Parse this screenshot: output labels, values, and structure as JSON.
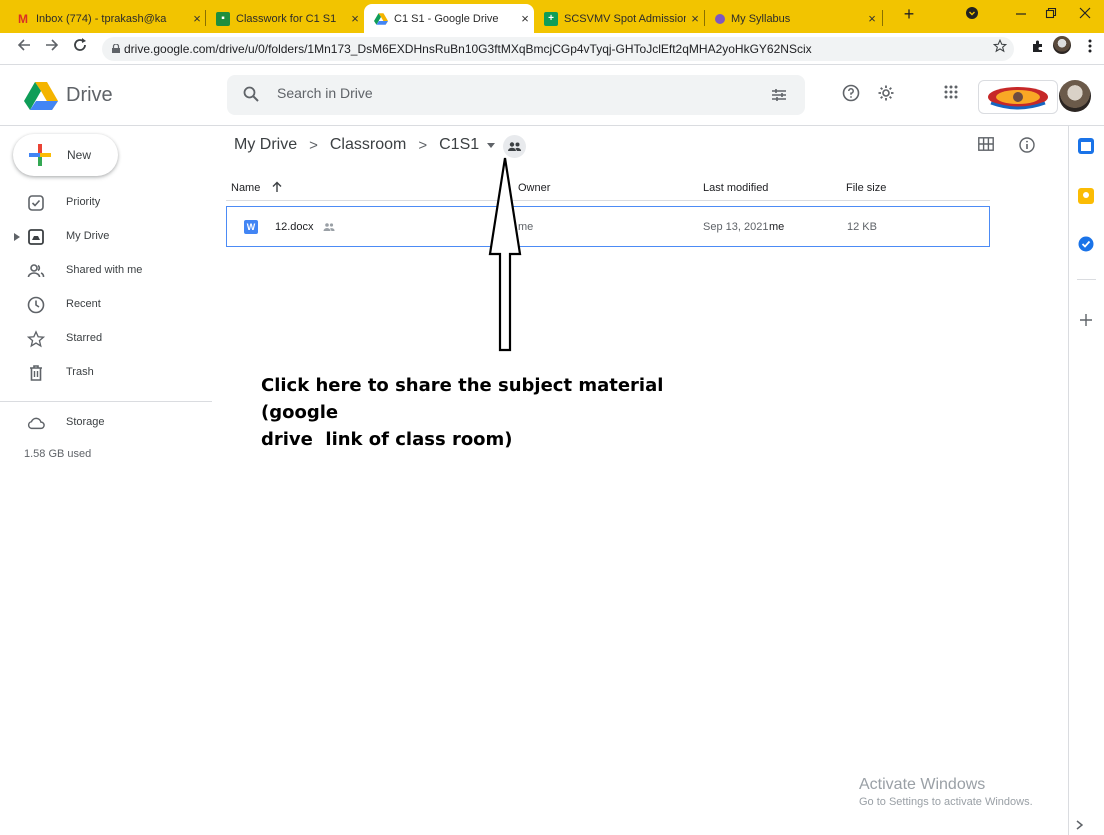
{
  "browser": {
    "tabs": [
      {
        "title": "Inbox (774) - tprakash@ka",
        "favicon": "gmail-icon",
        "active": false
      },
      {
        "title": "Classwork for C1 S1",
        "favicon": "classroom-icon",
        "active": false
      },
      {
        "title": "C1 S1 - Google Drive",
        "favicon": "drive-icon",
        "active": true
      },
      {
        "title": "SCSVMV Spot Admission",
        "favicon": "sheets-icon",
        "active": false
      },
      {
        "title": "My Syllabus",
        "favicon": "site-icon",
        "active": false
      }
    ],
    "close_glyph": "×",
    "new_tab_glyph": "+",
    "url": "drive.google.com/drive/u/0/folders/1Mn173_DsM6EXDHnsRuBn10G3ftMXqBmcjCGp4vTyqj-GHToJclEft2qMHA2yoHkGY62NScix"
  },
  "header": {
    "app_title": "Drive",
    "search_placeholder": "Search in Drive"
  },
  "sidebar": {
    "new_label": "New",
    "items": [
      {
        "label": "Priority",
        "icon": "priority-icon"
      },
      {
        "label": "My Drive",
        "icon": "my-drive-icon"
      },
      {
        "label": "Shared with me",
        "icon": "shared-icon"
      },
      {
        "label": "Recent",
        "icon": "clock-icon"
      },
      {
        "label": "Starred",
        "icon": "star-icon"
      },
      {
        "label": "Trash",
        "icon": "trash-icon"
      }
    ],
    "storage_label": "Storage",
    "storage_used": "1.58 GB used"
  },
  "main": {
    "breadcrumb": [
      "My Drive",
      "Classroom",
      "C1S1"
    ],
    "breadcrumb_sep": ">",
    "columns": {
      "name": "Name",
      "owner": "Owner",
      "last_modified": "Last modified",
      "file_size": "File size"
    },
    "files": [
      {
        "name": "12.docx",
        "owner": "me",
        "modified_date": "Sep 13, 2021",
        "modified_by": "me",
        "size": "12 KB"
      }
    ]
  },
  "annotation": {
    "line1": "Click here to share the subject material (google",
    "line2": "drive  link of class room)"
  },
  "windows_watermark": {
    "line1": "Activate Windows",
    "line2": "Go to Settings to activate Windows."
  },
  "colors": {
    "tab_strip": "#f2c400",
    "selection_border": "#4c8bf5",
    "drive_blue": "#4285f4",
    "drive_green": "#0f9d58",
    "drive_yellow": "#f4b400"
  }
}
